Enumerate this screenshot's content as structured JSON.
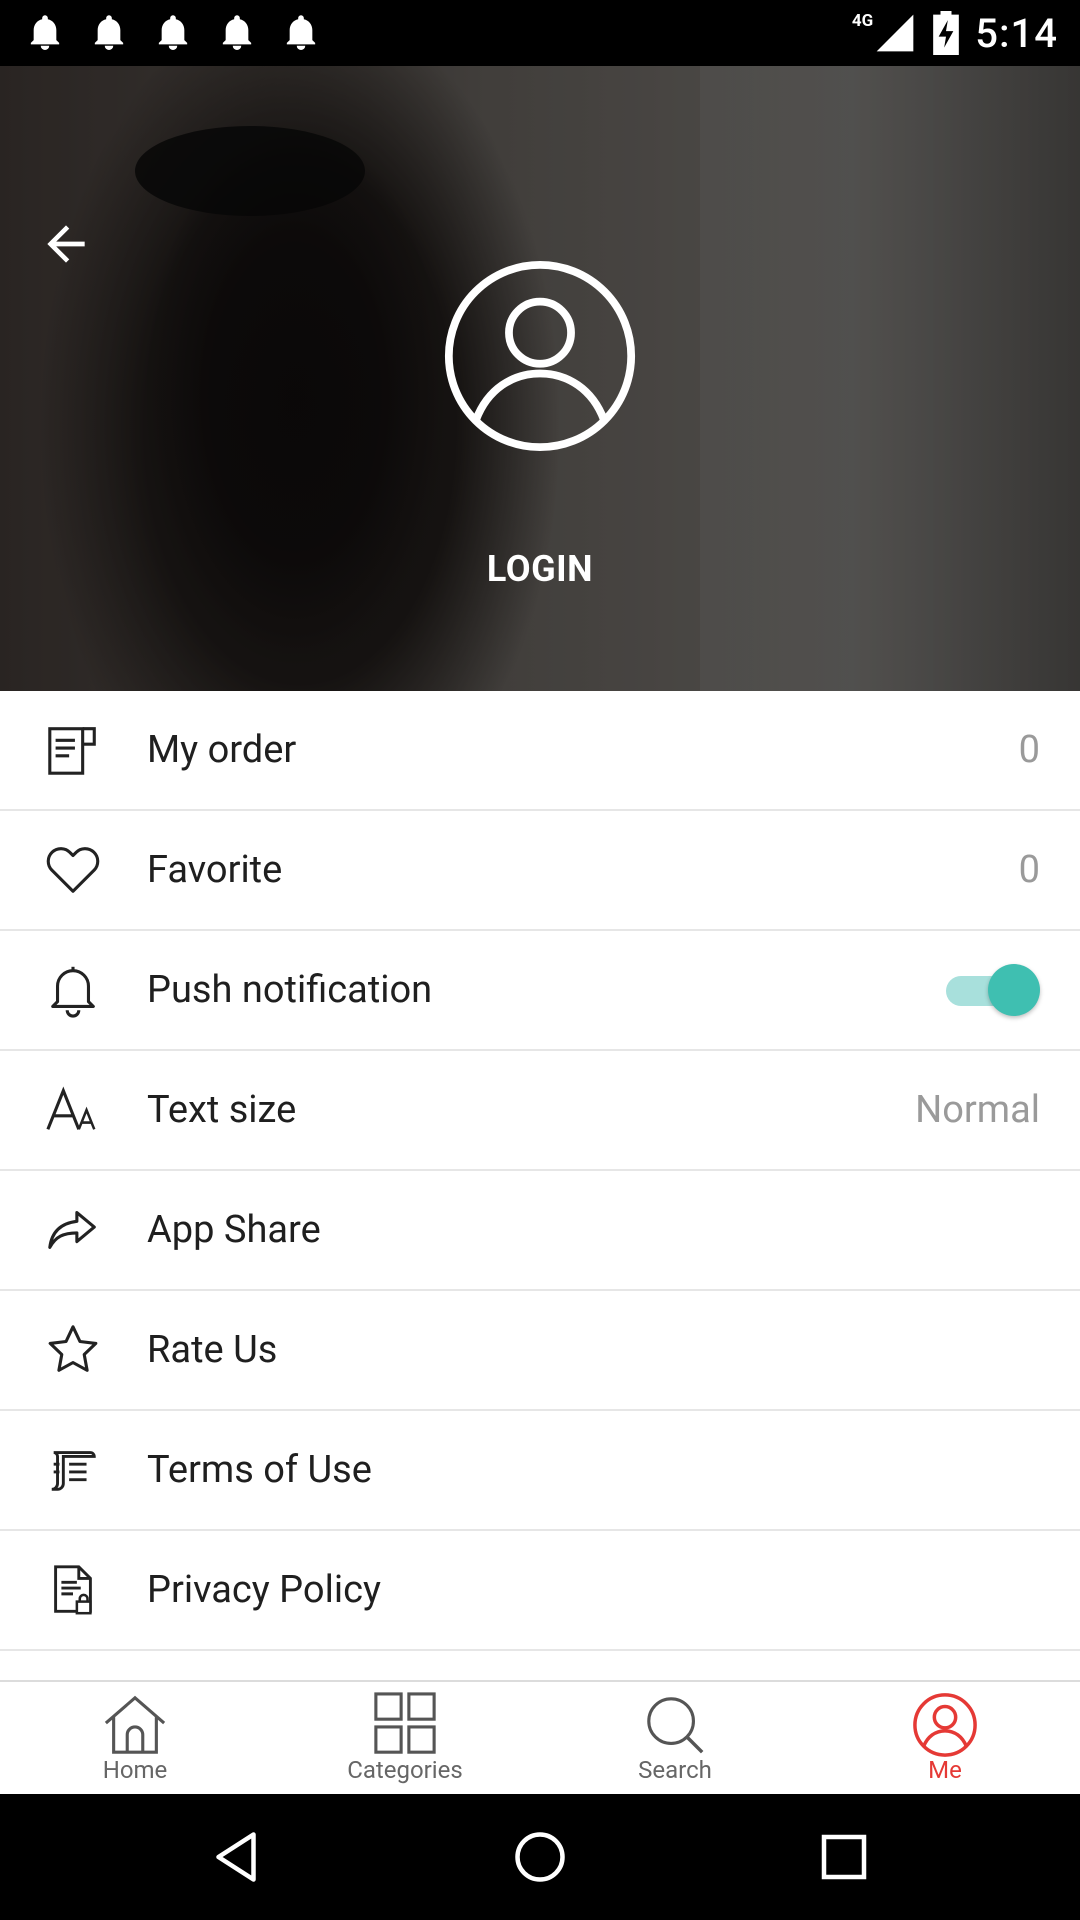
{
  "status_bar": {
    "time": "5:14",
    "network": "4G",
    "notification_icons": [
      "notification-bell-icon",
      "notification-bell-icon",
      "notification-bell-icon",
      "notification-bell-icon",
      "notification-bell-icon"
    ]
  },
  "hero": {
    "login_label": "LOGIN"
  },
  "menu": {
    "items": [
      {
        "label": "My order",
        "value": "0",
        "icon": "order-list-icon"
      },
      {
        "label": "Favorite",
        "value": "0",
        "icon": "heart-icon"
      },
      {
        "label": "Push notification",
        "toggle": true,
        "icon": "bell-icon"
      },
      {
        "label": "Text size",
        "value": "Normal",
        "icon": "text-size-icon"
      },
      {
        "label": "App Share",
        "icon": "share-icon"
      },
      {
        "label": "Rate Us",
        "icon": "star-icon"
      },
      {
        "label": "Terms of Use",
        "icon": "terms-document-icon"
      },
      {
        "label": "Privacy Policy",
        "icon": "privacy-document-icon"
      }
    ]
  },
  "bottom_nav": {
    "items": [
      {
        "label": "Home",
        "icon": "home-icon"
      },
      {
        "label": "Categories",
        "icon": "grid-icon"
      },
      {
        "label": "Search",
        "icon": "search-icon"
      },
      {
        "label": "Me",
        "icon": "profile-icon",
        "active": true
      }
    ]
  },
  "colors": {
    "accent_red": "#e53935",
    "toggle_teal": "#3fbfb1"
  }
}
